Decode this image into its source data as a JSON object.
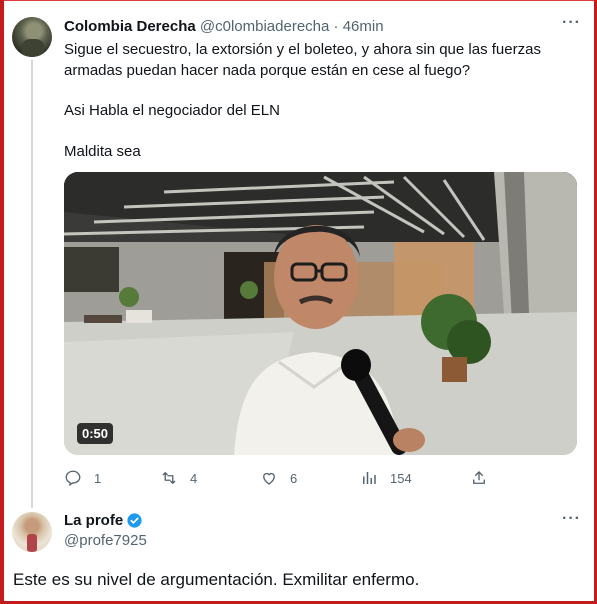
{
  "tweet": {
    "author_name": "Colombia Derecha",
    "author_handle": "@c0lombiaderecha",
    "separator": "·",
    "time": "46min",
    "lines": [
      "Sigue el secuestro, la extorsión y el boleteo, y ahora sin que las fuerzas",
      "armadas puedan hacer nada porque están en cese al fuego?",
      "Asi Habla el negociador del ELN",
      "Maldita sea"
    ],
    "video_duration": "0:50",
    "actions": {
      "replies": "1",
      "retweets": "4",
      "likes": "6",
      "views": "154"
    }
  },
  "reply": {
    "author_name": "La profe",
    "author_handle": "@profe7925",
    "text": "Este es su nivel de argumentación. Exmilitar enfermo."
  },
  "colors": {
    "frame": "#c41c1c",
    "verified": "#1d9bf0",
    "secondary_text": "#536471"
  },
  "icons": [
    "more-icon",
    "reply-icon",
    "retweet-icon",
    "like-icon",
    "views-icon",
    "share-icon",
    "verified-badge-icon"
  ]
}
